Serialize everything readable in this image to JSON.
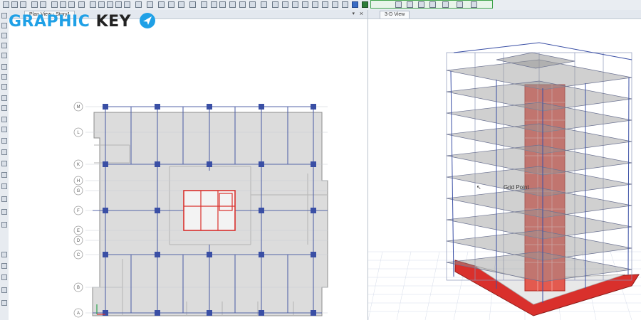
{
  "brand": {
    "part1": "GRAPHIC",
    "part2": "KEY"
  },
  "left_pane": {
    "tab_label": "Plan View - Story1",
    "close": "×",
    "pin": "▾",
    "grid_rows": [
      "M",
      "L",
      "K",
      "H",
      "G",
      "F",
      "E",
      "D",
      "C",
      "B",
      "A"
    ]
  },
  "right_pane": {
    "tab_label": "3-D View",
    "cursor_label": "Grid Point"
  },
  "colors": {
    "slab": "#dcdcdc",
    "beam": "#5566a8",
    "column": "#3a4fa5",
    "core": "#d9302c",
    "accent_logo": "#1fa0e6"
  }
}
